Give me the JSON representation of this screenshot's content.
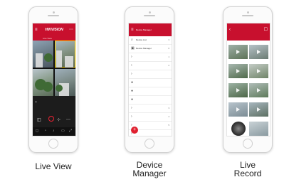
{
  "phones": {
    "live_view": {
      "caption": "Live View",
      "title": "HIKVISION",
      "tab_left": "Live View",
      "tab_right": "",
      "tool_icons": [
        "camera-icon",
        "record-icon",
        "ptz-icon",
        "more-icon"
      ]
    },
    "device_manager": {
      "caption_line1": "Device",
      "caption_line2": "Manager",
      "title": "Device Manager",
      "rows": [
        {
          "icon": "search-icon",
          "label": "Device List",
          "count": "3"
        },
        {
          "icon": "device-icon",
          "label": "Device Manager",
          "count": "6"
        },
        {
          "icon": "arrow-icon",
          "label": "",
          "count": "1"
        },
        {
          "icon": "arrow-icon",
          "label": "",
          "count": "2"
        },
        {
          "icon": "arrow-icon",
          "label": "",
          "count": ""
        },
        {
          "icon": "person-icon",
          "label": "",
          "count": ""
        },
        {
          "icon": "person-icon",
          "label": "",
          "count": ""
        },
        {
          "icon": "person-icon",
          "label": "",
          "count": ""
        },
        {
          "icon": "arrow-icon",
          "label": "",
          "count": "3"
        },
        {
          "icon": "arrow-icon",
          "label": "",
          "count": "4"
        },
        {
          "icon": "arrow-icon",
          "label": "",
          "count": "5"
        },
        {
          "icon": "arrow-icon",
          "label": "",
          "count": ""
        },
        {
          "icon": "arrow-icon",
          "label": "",
          "count": ""
        }
      ],
      "fab_label": "+"
    },
    "live_record": {
      "caption_line1": "Live",
      "caption_line2": "Record",
      "title": ""
    }
  },
  "colors": {
    "brand_red": "#c8102e",
    "fab_red": "#e0202f"
  }
}
